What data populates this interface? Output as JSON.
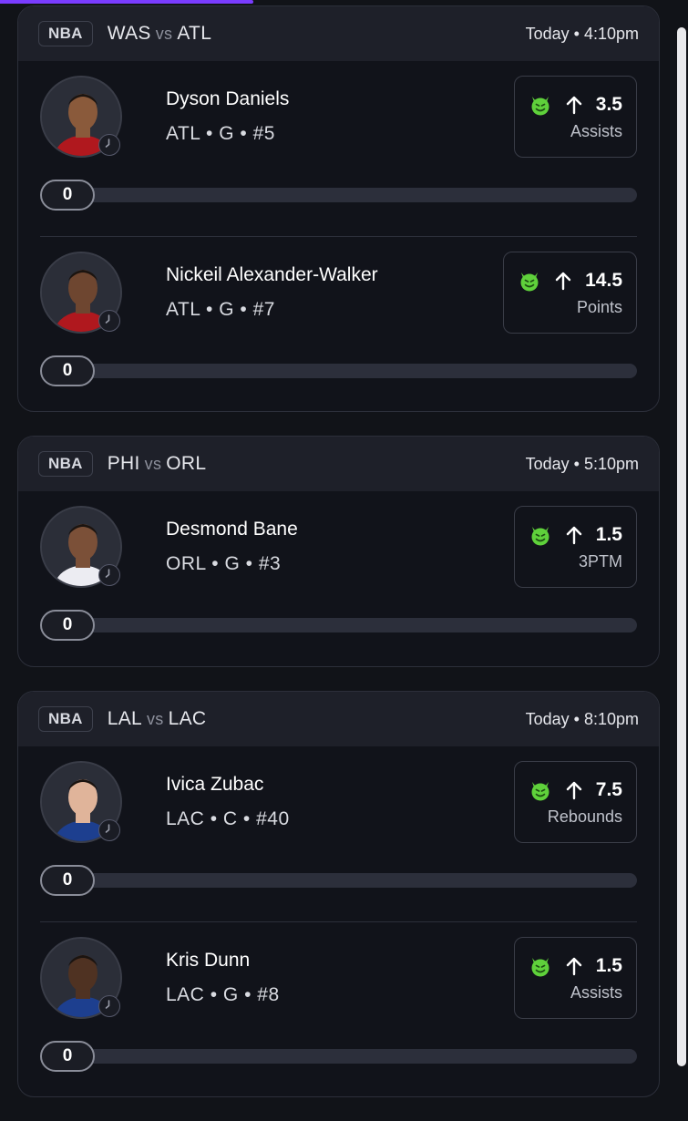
{
  "games": [
    {
      "league": "NBA",
      "home": "WAS",
      "vs": "vs",
      "away": "ATL",
      "day": "Today",
      "time": "4:10pm",
      "picks": [
        {
          "name": "Dyson Daniels",
          "team": "ATL",
          "pos": "G",
          "number": "#5",
          "direction": "over",
          "line": "3.5",
          "stat": "Assists",
          "progress": "0",
          "skin": "#8a5a3b",
          "jersey": "#b0181e"
        },
        {
          "name": "Nickeil Alexander-Walker",
          "team": "ATL",
          "pos": "G",
          "number": "#7",
          "direction": "over",
          "line": "14.5",
          "stat": "Points",
          "progress": "0",
          "skin": "#6e4630",
          "jersey": "#b0181e"
        }
      ]
    },
    {
      "league": "NBA",
      "home": "PHI",
      "vs": "vs",
      "away": "ORL",
      "day": "Today",
      "time": "5:10pm",
      "picks": [
        {
          "name": "Desmond Bane",
          "team": "ORL",
          "pos": "G",
          "number": "#3",
          "direction": "over",
          "line": "1.5",
          "stat": "3PTM",
          "progress": "0",
          "skin": "#7b5038",
          "jersey": "#ececf2"
        }
      ]
    },
    {
      "league": "NBA",
      "home": "LAL",
      "vs": "vs",
      "away": "LAC",
      "day": "Today",
      "time": "8:10pm",
      "picks": [
        {
          "name": "Ivica Zubac",
          "team": "LAC",
          "pos": "C",
          "number": "#40",
          "direction": "over",
          "line": "7.5",
          "stat": "Rebounds",
          "progress": "0",
          "skin": "#e0b49a",
          "jersey": "#1d3f8f"
        },
        {
          "name": "Kris Dunn",
          "team": "LAC",
          "pos": "G",
          "number": "#8",
          "direction": "over",
          "line": "1.5",
          "stat": "Assists",
          "progress": "0",
          "skin": "#4f3222",
          "jersey": "#1d3f8f"
        }
      ]
    }
  ],
  "icons": {
    "pick_icon": "green-devil-icon",
    "direction_icon": "arrow-up-icon",
    "status_icon": "clock-icon"
  },
  "colors": {
    "accent": "#7a3cff",
    "devil": "#5fd13b",
    "card_bg": "#11131a",
    "header_bg": "#1e2029"
  }
}
